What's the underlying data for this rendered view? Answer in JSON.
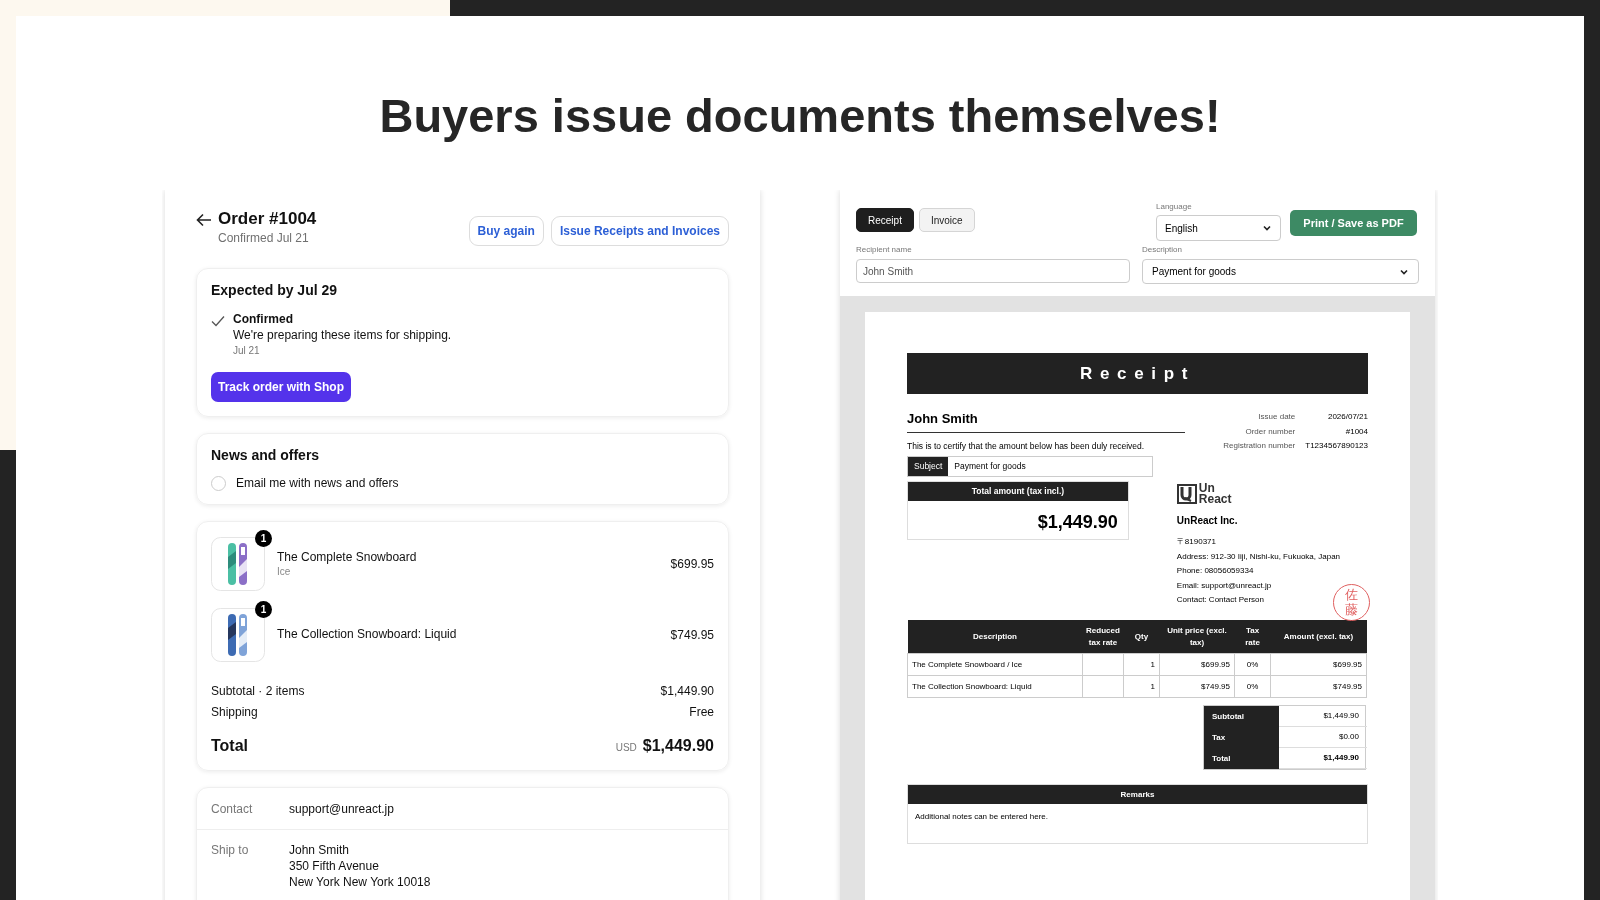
{
  "headline": "Buyers issue documents themselves!",
  "order_panel": {
    "title": "Order #1004",
    "subtitle": "Confirmed Jul 21",
    "buttons": [
      "Buy again",
      "Issue Receipts and Invoices"
    ],
    "delivery": {
      "heading": "Expected by Jul 29",
      "status": "Confirmed",
      "message": "We're preparing these items for shipping.",
      "date": "Jul 21",
      "button": "Track order with Shop"
    },
    "newsletter": {
      "heading": "News and offers",
      "label": "Email me with news and offers",
      "checked": false
    },
    "items": [
      {
        "name": "The Complete Snowboard",
        "variant": "Ice",
        "price": "$699.95",
        "quantity": "1"
      },
      {
        "name": "The Collection Snowboard: Liquid",
        "price": "$749.95",
        "quantity": "1"
      }
    ],
    "summary": [
      {
        "label": "Subtotal · 2 items",
        "value": "$1,449.90"
      },
      {
        "label": "Shipping",
        "value": "Free"
      }
    ],
    "total": {
      "label": "Total",
      "currency": "USD",
      "value": "$1,449.90"
    },
    "contact": {
      "label": "Contact",
      "value": "support@unreact.jp"
    },
    "ship_to": {
      "label": "Ship to",
      "lines": [
        "John Smith",
        "350 Fifth Avenue",
        "New York New York 10018"
      ]
    }
  },
  "document_panel": {
    "tabs": [
      {
        "label": "Receipt",
        "selected": true
      },
      {
        "label": "Invoice",
        "selected": false
      }
    ],
    "language": {
      "label": "Language",
      "value": "English"
    },
    "print_button": "Print / Save as PDF",
    "recipient": {
      "label": "Recipient name",
      "value": "John Smith"
    },
    "description": {
      "label": "Description",
      "value": "Payment for goods"
    },
    "receipt": {
      "title": "Receipt",
      "recipient": "John Smith",
      "statement": "This is to certify that the amount below has been duly received.",
      "subject_label": "Subject",
      "subject": "Payment for goods",
      "meta": [
        {
          "label": "Issue date",
          "value": "2026/07/21"
        },
        {
          "label": "Order number",
          "value": "#1004"
        },
        {
          "label": "Registration number",
          "value": "T1234567890123"
        }
      ],
      "total_label": "Total amount (tax incl.)",
      "total_value": "$1,449.90",
      "company": {
        "logo_text": "Un React",
        "name": "UnReact Inc.",
        "lines": [
          "〒8190371",
          "Address: 912-30 Iiji, Nishi-ku, Fukuoka, Japan",
          "Phone: 08056059334",
          "Email: support@unreact.jp",
          "Contact: Contact Person"
        ],
        "seal": "佐藤"
      },
      "table": {
        "columns": [
          "Description",
          "Reduced tax rate",
          "Qty",
          "Unit price (excl. tax)",
          "Tax rate",
          "Amount (excl. tax)"
        ],
        "rows": [
          [
            "The Complete Snowboard / Ice",
            "",
            "1",
            "$699.95",
            "0%",
            "$699.95"
          ],
          [
            "The Collection Snowboard: Liquid",
            "",
            "1",
            "$749.95",
            "0%",
            "$749.95"
          ]
        ]
      },
      "totals": [
        {
          "label": "Subtotal",
          "value": "$1,449.90",
          "kind": "line"
        },
        {
          "label": "Tax",
          "value": "$0.00",
          "kind": "line"
        },
        {
          "label": "Total",
          "value": "$1,449.90",
          "kind": "total"
        }
      ],
      "remarks": {
        "heading": "Remarks",
        "text": "Additional notes can be entered here."
      }
    }
  }
}
